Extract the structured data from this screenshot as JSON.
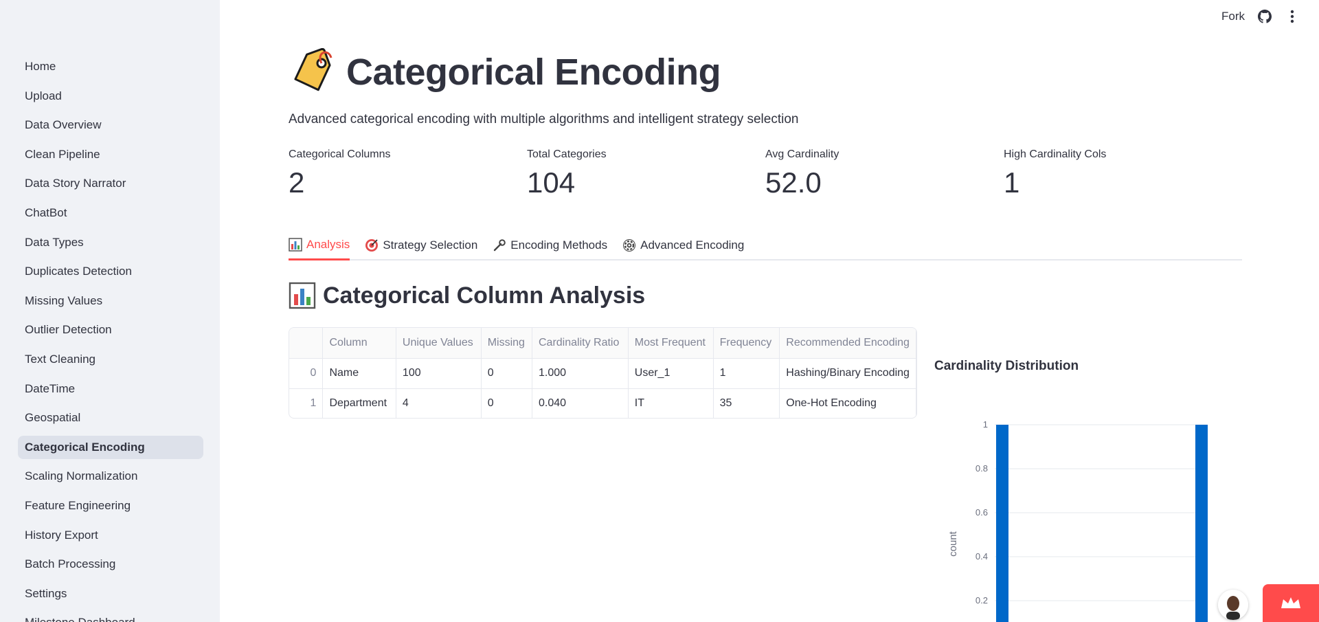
{
  "sidebar": {
    "items": [
      {
        "label": "Home"
      },
      {
        "label": "Upload"
      },
      {
        "label": "Data Overview"
      },
      {
        "label": "Clean Pipeline"
      },
      {
        "label": "Data Story Narrator"
      },
      {
        "label": "ChatBot"
      },
      {
        "label": "Data Types"
      },
      {
        "label": "Duplicates Detection"
      },
      {
        "label": "Missing Values"
      },
      {
        "label": "Outlier Detection"
      },
      {
        "label": "Text Cleaning"
      },
      {
        "label": "DateTime"
      },
      {
        "label": "Geospatial"
      },
      {
        "label": "Categorical Encoding",
        "active": true
      },
      {
        "label": "Scaling Normalization"
      },
      {
        "label": "Feature Engineering"
      },
      {
        "label": "History Export"
      },
      {
        "label": "Batch Processing"
      },
      {
        "label": "Settings"
      },
      {
        "label": "Milestone Dashboard"
      }
    ]
  },
  "topbar": {
    "fork_label": "Fork",
    "github_icon": "github-icon",
    "menu_icon": "kebab-menu-icon"
  },
  "page": {
    "title": "Categorical Encoding",
    "title_icon": "label-tag-icon",
    "subtitle": "Advanced categorical encoding with multiple algorithms and intelligent strategy selection"
  },
  "metrics": [
    {
      "label": "Categorical Columns",
      "value": "2"
    },
    {
      "label": "Total Categories",
      "value": "104"
    },
    {
      "label": "Avg Cardinality",
      "value": "52.0"
    },
    {
      "label": "High Cardinality Cols",
      "value": "1"
    }
  ],
  "tabs": [
    {
      "label": "Analysis",
      "icon": "bar-chart-icon",
      "active": true
    },
    {
      "label": "Strategy Selection",
      "icon": "target-icon"
    },
    {
      "label": "Encoding Methods",
      "icon": "wrench-icon"
    },
    {
      "label": "Advanced Encoding",
      "icon": "gear-icon"
    }
  ],
  "section": {
    "title": "Categorical Column Analysis",
    "icon": "bar-chart-icon"
  },
  "table": {
    "columns": [
      "",
      "Column",
      "Unique Values",
      "Missing",
      "Cardinality Ratio",
      "Most Frequent",
      "Frequency",
      "Recommended Encoding"
    ],
    "rows": [
      [
        "0",
        "Name",
        "100",
        "0",
        "1.000",
        "User_1",
        "1",
        "Hashing/Binary Encoding"
      ],
      [
        "1",
        "Department",
        "4",
        "0",
        "0.040",
        "IT",
        "35",
        "One-Hot Encoding"
      ]
    ]
  },
  "chart_data": {
    "type": "bar",
    "title": "Cardinality Distribution",
    "ylabel": "count",
    "ylim": [
      0,
      1
    ],
    "y_ticks": [
      "1",
      "0.8",
      "0.6",
      "0.4",
      "0.2"
    ],
    "values": [
      1,
      1
    ],
    "colors": {
      "bar": "#0068c9",
      "grid": "#e6e8ee"
    }
  },
  "colors": {
    "accent": "#ff4b4b",
    "sidebar_bg": "#f0f2f6",
    "active_nav": "#dde1ea"
  }
}
